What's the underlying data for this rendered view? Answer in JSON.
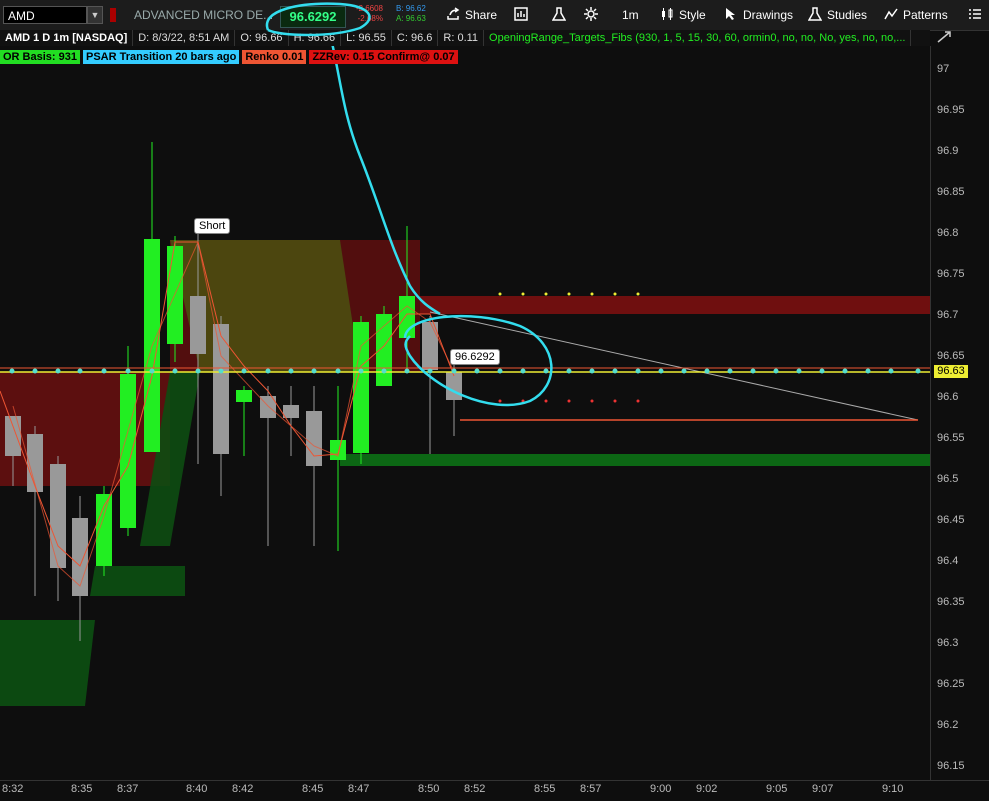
{
  "toolbar": {
    "symbol": "AMD",
    "company": "ADVANCED MICRO DE...",
    "last_price": "96.6292",
    "change_abs": "-2.6608",
    "change_pct": "-2.68%",
    "bid": "B: 96.62",
    "ask": "A: 96.63",
    "share": "Share",
    "timeframe": "1m",
    "style": "Style",
    "drawings": "Drawings",
    "studies": "Studies",
    "patterns": "Patterns"
  },
  "infobar": {
    "symbol": "AMD 1 D 1m [NASDAQ]",
    "date": "D: 8/3/22, 8:51 AM",
    "open": "O: 96.66",
    "high": "H: 96.66",
    "low": "L: 96.55",
    "close": "C: 96.6",
    "range": "R: 0.11",
    "study": "OpeningRange_Targets_Fibs (930, 1, 5, 15, 30, 60, ormin0, no, no, No, yes, no, no,..."
  },
  "study_labels": {
    "or_basis": "OR Basis: 931",
    "psar": "PSAR Transition 20 bars ago",
    "renko": "Renko 0.01",
    "zz": "ZZRev: 0.15 Confirm@ 0.07"
  },
  "callouts": {
    "short": "Short",
    "price": "96.6292"
  },
  "yaxis": {
    "ticks": [
      "97",
      "96.95",
      "96.9",
      "96.85",
      "96.8",
      "96.75",
      "96.7",
      "96.65",
      "96.6",
      "96.55",
      "96.5",
      "96.45",
      "96.4",
      "96.35",
      "96.3",
      "96.25",
      "96.2",
      "96.15"
    ],
    "current": "96.63"
  },
  "xaxis": {
    "ticks": [
      "8:32",
      "8:35",
      "8:37",
      "8:40",
      "8:42",
      "8:45",
      "8:47",
      "8:50",
      "8:52",
      "8:55",
      "8:57",
      "9:00",
      "9:02",
      "9:05",
      "9:07",
      "9:10"
    ]
  },
  "colors": {
    "up": "#22ee22",
    "down": "#999999",
    "price_line": "#eeee33",
    "annotation": "#33ddee"
  }
}
